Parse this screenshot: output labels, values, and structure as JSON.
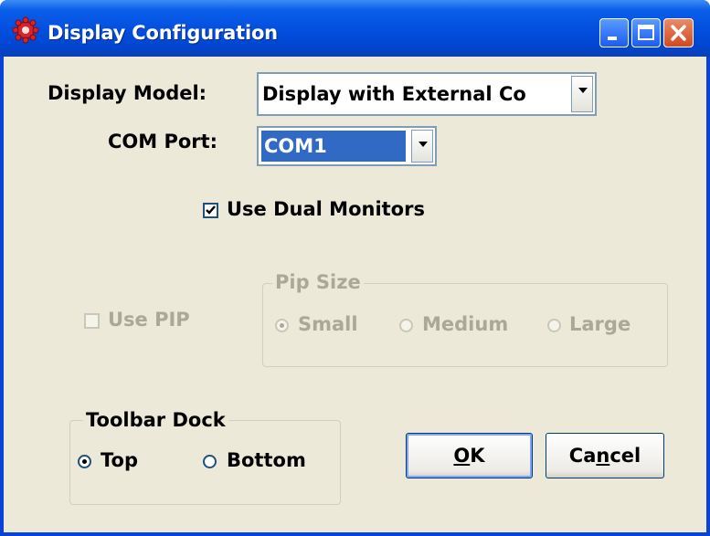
{
  "window": {
    "title": "Display Configuration"
  },
  "form": {
    "display_model_label": "Display Model:",
    "display_model_value": "Display with External Co",
    "com_port_label": "COM Port:",
    "com_port_value": "COM1",
    "dual_monitors_label": "Use Dual Monitors",
    "dual_monitors_checked": true,
    "use_pip_label": "Use PIP",
    "use_pip_checked": false
  },
  "pip_size": {
    "title": "Pip Size",
    "options": [
      "Small",
      "Medium",
      "Large"
    ],
    "selected": "Small"
  },
  "toolbar_dock": {
    "title": "Toolbar Dock",
    "options": [
      "Top",
      "Bottom"
    ],
    "selected": "Top"
  },
  "buttons": {
    "ok_mnemonic": "O",
    "ok_rest": "K",
    "cancel_pre": "Ca",
    "cancel_mnemonic": "n",
    "cancel_post": "cel"
  }
}
